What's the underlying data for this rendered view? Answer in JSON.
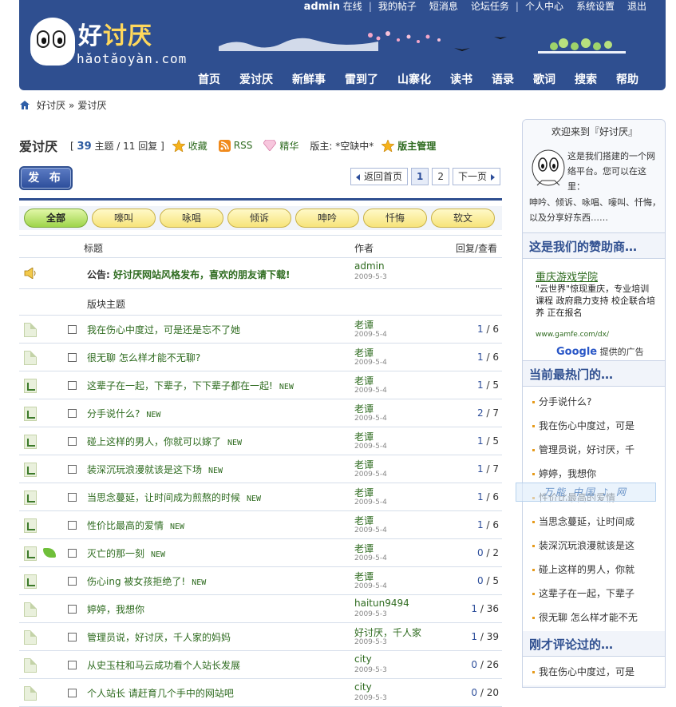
{
  "top_nav": {
    "user": "admin",
    "status": "在线",
    "items": [
      "我的帖子",
      "短消息",
      "论坛任务",
      "个人中心",
      "系统设置",
      "退出"
    ]
  },
  "logo": {
    "name_part1": "好",
    "name_part2": "讨厌",
    "pinyin": "hǎotǎoyàn.com"
  },
  "main_nav": [
    "首页",
    "爱讨厌",
    "新鲜事",
    "雷到了",
    "山寨化",
    "读书",
    "语录",
    "歌词",
    "搜索",
    "帮助"
  ],
  "breadcrumb": {
    "home": "好讨厌",
    "sep": "»",
    "current": "爱讨厌"
  },
  "forum": {
    "title": "爱讨厌",
    "counts": {
      "open": "[",
      "topics": "39",
      "topics_label": "主题 /",
      "replies": "11",
      "replies_label": "回复 ]"
    },
    "favorite": "收藏",
    "rss": "RSS",
    "digest": "精华",
    "moderator": "版主: *空缺中*",
    "mod_manage": "版主管理"
  },
  "post_button": "发 布",
  "pager": {
    "back": "返回首页",
    "pages": [
      "1",
      "2"
    ],
    "current": "1",
    "next": "下一页"
  },
  "filters": [
    "全部",
    "嚎叫",
    "咏唱",
    "倾诉",
    "呻吟",
    "忏悔",
    "软文"
  ],
  "table": {
    "headers": {
      "title": "标题",
      "author": "作者",
      "stats": "回复/查看"
    },
    "announcement": {
      "prefix": "公告:",
      "title": "好讨厌网站风格发布，喜欢的朋友请下载!",
      "author": "admin",
      "date": "2009-5-3"
    },
    "section_label": "版块主题",
    "new_tag": "NEW",
    "rows": [
      {
        "title": "我在伤心中度过，可是还是忘不了她",
        "author": "老谭",
        "date": "2009-5-4",
        "replies": "1",
        "views": "/ 6",
        "new": "",
        "icon": "doc",
        "leaf": false
      },
      {
        "title": "很无聊 怎么样才能不无聊?",
        "author": "老谭",
        "date": "2009-5-4",
        "replies": "1",
        "views": "/ 6",
        "new": "",
        "icon": "doc",
        "leaf": false
      },
      {
        "title": "这辈子在一起，下辈子，下下辈子都在一起!",
        "author": "老谭",
        "date": "2009-5-4",
        "replies": "1",
        "views": "/ 5",
        "new": "NEW",
        "icon": "reply",
        "leaf": false
      },
      {
        "title": "分手说什么?",
        "author": "老谭",
        "date": "2009-5-4",
        "replies": "2",
        "views": "/ 7",
        "new": "NEW",
        "icon": "reply",
        "leaf": false
      },
      {
        "title": "碰上这样的男人，你就可以嫁了",
        "author": "老谭",
        "date": "2009-5-4",
        "replies": "1",
        "views": "/ 5",
        "new": "NEW",
        "icon": "reply",
        "leaf": false
      },
      {
        "title": "装深沉玩浪漫就该是这下场",
        "author": "老谭",
        "date": "2009-5-4",
        "replies": "1",
        "views": "/ 7",
        "new": "NEW",
        "icon": "reply",
        "leaf": false
      },
      {
        "title": "当思念蔓延，让时间成为煎熬的时候",
        "author": "老谭",
        "date": "2009-5-4",
        "replies": "1",
        "views": "/ 6",
        "new": "NEW",
        "icon": "reply",
        "leaf": false
      },
      {
        "title": "性价比最高的爱情",
        "author": "老谭",
        "date": "2009-5-4",
        "replies": "1",
        "views": "/ 6",
        "new": "NEW",
        "icon": "reply",
        "leaf": false
      },
      {
        "title": "灭亡的那一刻",
        "author": "老谭",
        "date": "2009-5-4",
        "replies": "0",
        "views": "/ 2",
        "new": "NEW",
        "icon": "reply",
        "leaf": true
      },
      {
        "title": "伤心ing 被女孩拒绝了!",
        "author": "老谭",
        "date": "2009-5-4",
        "replies": "0",
        "views": "/ 5",
        "new": "NEW",
        "icon": "reply",
        "leaf": false
      },
      {
        "title": "婷婷，我想你",
        "author": "haitun9494",
        "date": "2009-5-3",
        "replies": "1",
        "views": "/ 36",
        "new": "",
        "icon": "doc",
        "leaf": false
      },
      {
        "title": "管理员说，好讨厌，千人家的妈妈",
        "author": "好讨厌，千人家",
        "date": "2009-5-3",
        "replies": "1",
        "views": "/ 39",
        "new": "",
        "icon": "doc",
        "leaf": false
      },
      {
        "title": "从史玉柱和马云成功看个人站长发展",
        "author": "city",
        "date": "2009-5-3",
        "replies": "0",
        "views": "/ 26",
        "new": "",
        "icon": "doc",
        "leaf": false
      },
      {
        "title": "个人站长 请赶育几个手中的网站吧",
        "author": "city",
        "date": "2009-5-3",
        "replies": "0",
        "views": "/ 20",
        "new": "",
        "icon": "doc",
        "leaf": false
      }
    ]
  },
  "sidebar": {
    "welcome_title": "欢迎来到『好讨厌』",
    "intro": "这是我们搭建的一个网络平台。您可以在这里：",
    "intro2": "呻吟、倾诉、咏唱、嚎叫、忏悔，以及分享好东西……",
    "sponsor_title": "这是我们的赞助商…",
    "ad_title": "重庆游戏学院",
    "ad_text": "\"云世界\"惊现重庆，专业培训课程 政府鼎力支持 校企联合培养 正在报名",
    "ad_url": "www.gamfe.com/dx/",
    "google_word": "Google",
    "google_note": "提供的广告",
    "hot_title": "当前最热门的…",
    "hot_items": [
      "分手说什么?",
      "我在伤心中度过，可是",
      "管理员说，好讨厌，千",
      "婷婷，我想你",
      "性价比最高的爱情",
      "当思念蔓延，让时间成",
      "装深沉玩浪漫就该是这",
      "碰上这样的男人，你就",
      "这辈子在一起，下辈子",
      "很无聊 怎么样才能不无"
    ],
    "recent_title": "刚才评论过的…",
    "recent_items": [
      "我在伤心中度过，可是"
    ]
  },
  "watermark": "万能 中国 ♪ 网"
}
